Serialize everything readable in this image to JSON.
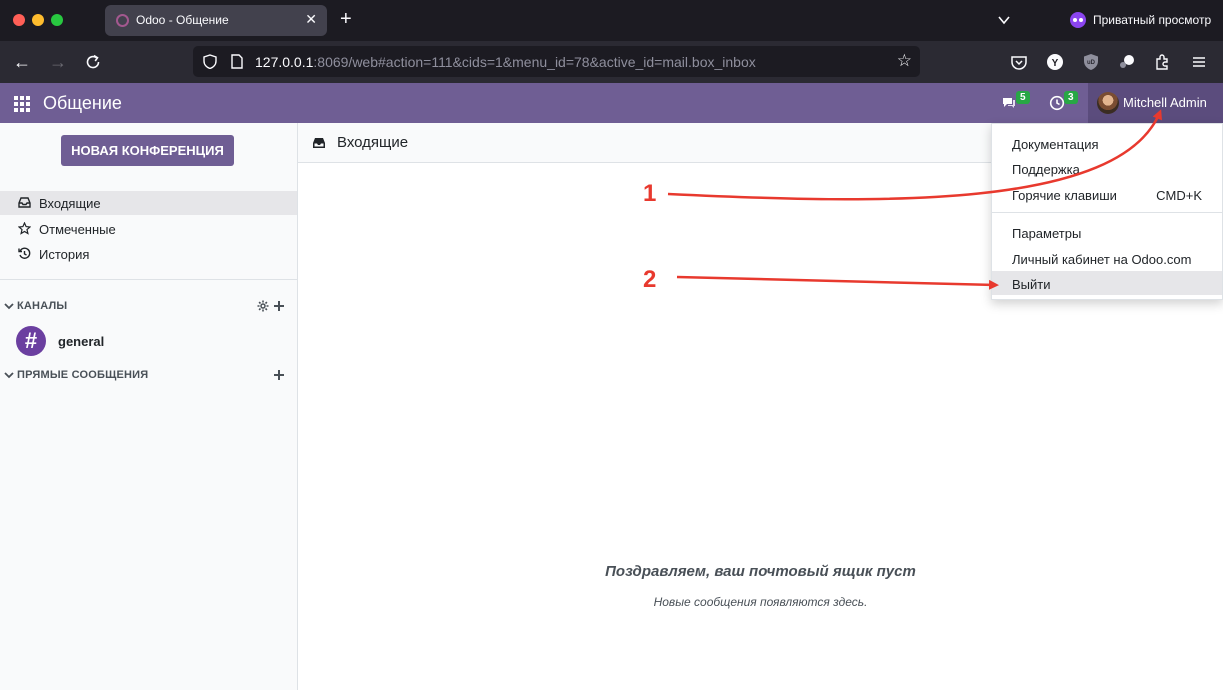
{
  "browser": {
    "tab_title": "Odoo - Общение",
    "tab_close": "✕",
    "new_tab": "+",
    "private_label": "Приватный просмотр",
    "url_host": "127.0.0.1",
    "url_rest": ":8069/web#action=111&cids=1&menu_id=78&active_id=mail.box_inbox"
  },
  "topbar": {
    "app_title": "Общение",
    "messages_badge": "5",
    "activities_badge": "3",
    "user_name": "Mitchell Admin"
  },
  "sidebar": {
    "new_meeting_label": "НОВАЯ КОНФЕРЕНЦИЯ",
    "items": [
      {
        "label": "Входящие"
      },
      {
        "label": "Отмеченные"
      },
      {
        "label": "История"
      }
    ],
    "channels_label": "КАНАЛЫ",
    "channel_name": "general",
    "direct_label": "ПРЯМЫЕ СООБЩЕНИЯ"
  },
  "main": {
    "title": "Входящие",
    "empty_title": "Поздравляем, ваш почтовый ящик пуст",
    "empty_subtitle": "Новые сообщения появляются здесь."
  },
  "user_menu": {
    "items": [
      {
        "label": "Документация"
      },
      {
        "label": "Поддержка"
      },
      {
        "label": "Горячие клавиши",
        "shortcut": "CMD+K"
      },
      {
        "label": "Параметры"
      },
      {
        "label": "Личный кабинет на Odoo.com"
      },
      {
        "label": "Выйти"
      }
    ]
  },
  "annotations": {
    "step1": "1",
    "step2": "2",
    "color": "#e8392e"
  },
  "colors": {
    "odoo_purple": "#6f5e94",
    "badge_green": "#28a745"
  }
}
